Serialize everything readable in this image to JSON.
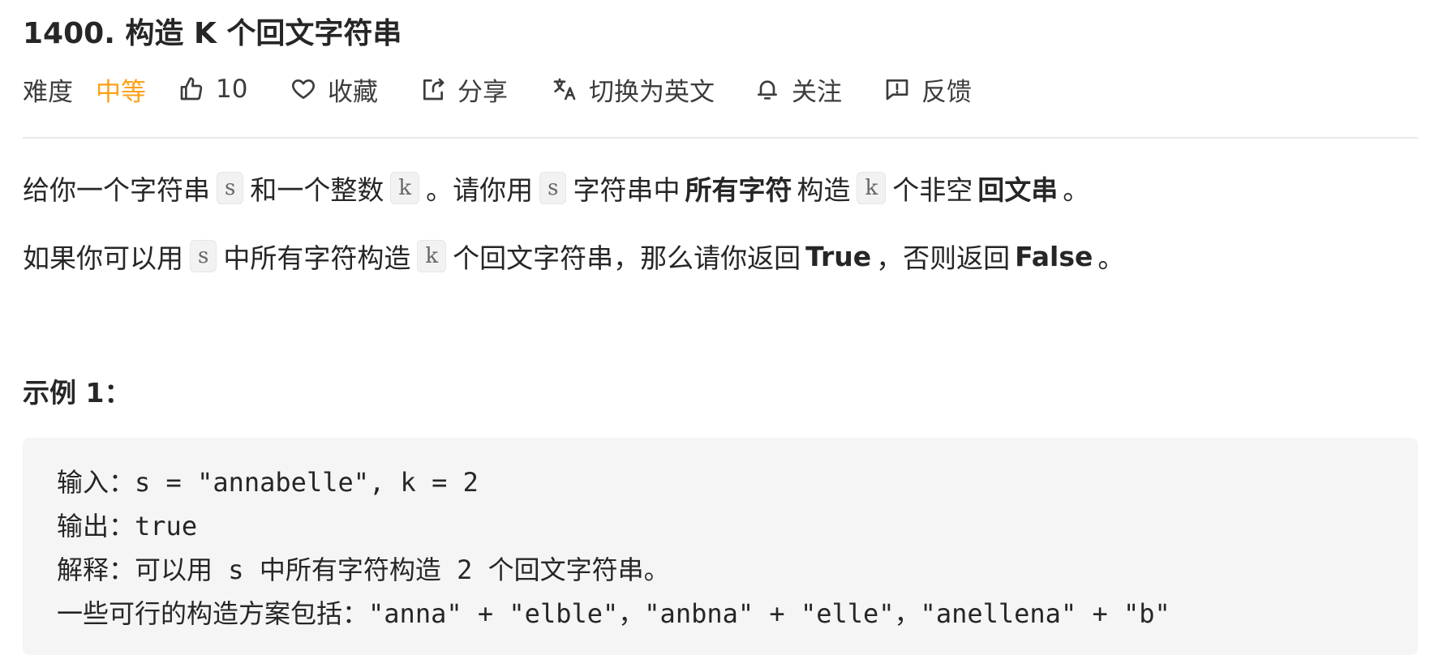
{
  "problem": {
    "title": "1400. 构造 K 个回文字符串"
  },
  "toolbar": {
    "difficulty_label": "难度",
    "difficulty_value": "中等",
    "like_count": "10",
    "favorite_label": "收藏",
    "share_label": "分享",
    "switch_lang_label": "切换为英文",
    "follow_label": "关注",
    "feedback_label": "反馈",
    "colors": {
      "difficulty_medium": "#ffa116"
    }
  },
  "description": {
    "p1": {
      "t1": "给你一个字符串",
      "c1": "s",
      "t2": "和一个整数",
      "c2": "k",
      "t3": "。请你用",
      "c3": "s",
      "t4": "字符串中",
      "b1": "所有字符",
      "t5": "构造",
      "c4": "k",
      "t6": "个非空",
      "b2": "回文串",
      "t7": "。"
    },
    "p2": {
      "t1": "如果你可以用",
      "c1": "s",
      "t2": "中所有字符构造",
      "c2": "k",
      "t3": "个回文字符串，那么请你返回",
      "b1": "True",
      "t4": "，否则返回",
      "b2": "False",
      "t5": "。"
    }
  },
  "example": {
    "title": "示例 1：",
    "input_label": "输入：",
    "input_value": "s = \"annabelle\", k = 2",
    "output_label": "输出：",
    "output_value": "true",
    "explain_label": "解释：",
    "explain_text_a": "可以用",
    "explain_code_a": " s ",
    "explain_text_b": "中所有字符构造",
    "explain_code_b": " 2 ",
    "explain_text_c": "个回文字符串。",
    "cases_label": "一些可行的构造方案包括：",
    "case1": "\"anna\" + \"elble\"",
    "sep1": "，",
    "case2": "\"anbna\" + \"elle\"",
    "sep2": "，",
    "case3": "\"anellena\" + \"b\""
  }
}
